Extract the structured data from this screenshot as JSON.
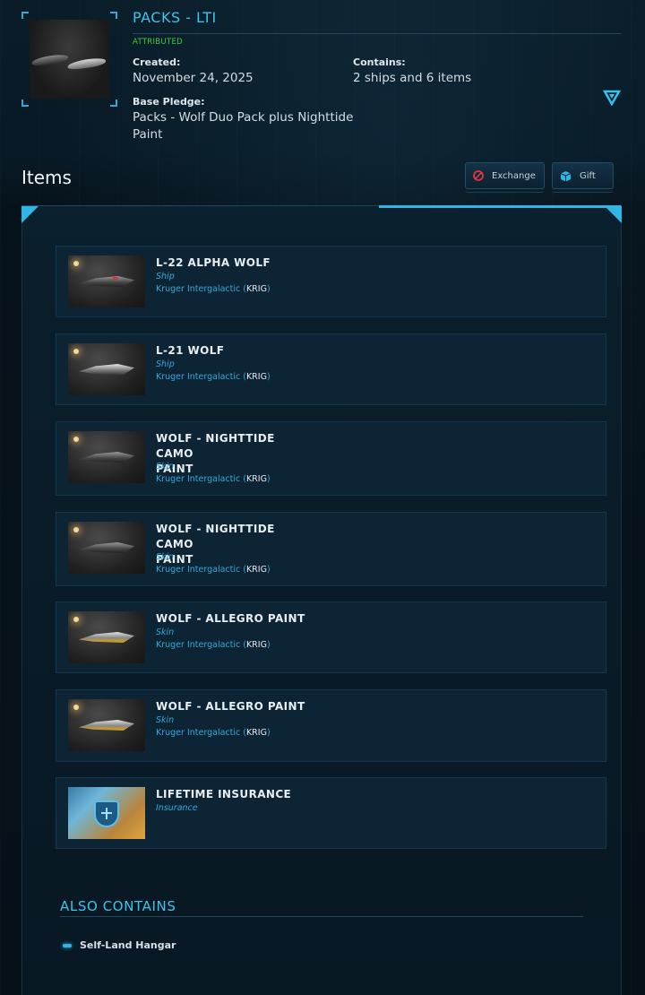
{
  "pack": {
    "title": "PACKS - LTI",
    "status": "ATTRIBUTED",
    "created_label": "Created:",
    "created_value": "November 24, 2025",
    "contains_label": "Contains:",
    "contains_value": "2 ships and 6 items",
    "base_pledge_label": "Base Pledge:",
    "base_pledge_line1": "Packs - Wolf Duo Pack plus Nighttide",
    "base_pledge_line2": "Paint"
  },
  "items_section": {
    "heading": "Items",
    "exchange_label": "Exchange",
    "gift_label": "Gift"
  },
  "items": [
    {
      "name": "L-22 ALPHA WOLF",
      "name2": "",
      "type": "Ship",
      "maker": "Kruger Intergalactic",
      "code": "KRIG"
    },
    {
      "name": "L-21 WOLF",
      "name2": "",
      "type": "Ship",
      "maker": "Kruger Intergalactic",
      "code": "KRIG"
    },
    {
      "name": "WOLF - NIGHTTIDE CAMO",
      "name2": "PAINT",
      "type": "Skin",
      "maker": "Kruger Intergalactic",
      "code": "KRIG"
    },
    {
      "name": "WOLF - NIGHTTIDE CAMO",
      "name2": "PAINT",
      "type": "Skin",
      "maker": "Kruger Intergalactic",
      "code": "KRIG"
    },
    {
      "name": "WOLF - ALLEGRO PAINT",
      "name2": "",
      "type": "Skin",
      "maker": "Kruger Intergalactic",
      "code": "KRIG"
    },
    {
      "name": "WOLF - ALLEGRO PAINT",
      "name2": "",
      "type": "Skin",
      "maker": "Kruger Intergalactic",
      "code": "KRIG"
    },
    {
      "name": "LIFETIME INSURANCE",
      "name2": "",
      "type": "Insurance",
      "maker": "",
      "code": ""
    }
  ],
  "also_contains": {
    "heading": "ALSO CONTAINS",
    "entries": [
      "Self-Land Hangar"
    ]
  },
  "colors": {
    "accent": "#2fb6e3",
    "attributed": "#3cd13a",
    "background": "#071824"
  },
  "icons": {
    "exchange": "exchange-icon",
    "gift": "gift-icon",
    "expand": "triangle-down-icon"
  }
}
